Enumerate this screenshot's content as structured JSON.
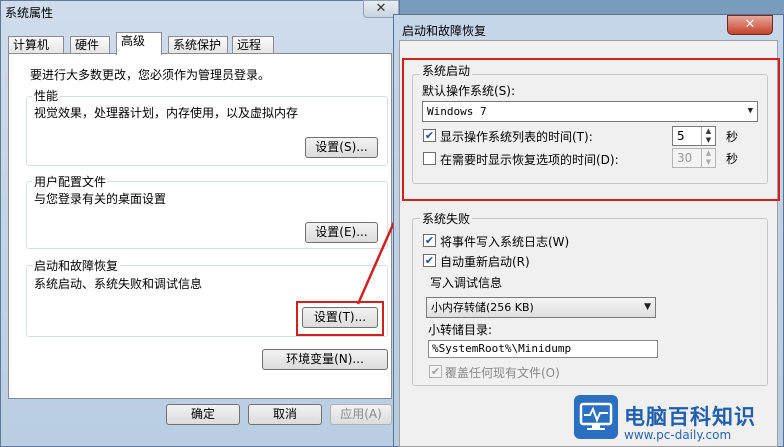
{
  "sysprops": {
    "title": "系统属性",
    "tabs": [
      "计算机名",
      "硬件",
      "高级",
      "系统保护",
      "远程"
    ],
    "intro": "要进行大多数更改，您必须作为管理员登录。",
    "performance": {
      "label": "性能",
      "desc": "视觉效果，处理器计划，内存使用，以及虚拟内存",
      "button": "设置(S)..."
    },
    "profiles": {
      "label": "用户配置文件",
      "desc": "与您登录有关的桌面设置",
      "button": "设置(E)..."
    },
    "startup": {
      "label": "启动和故障恢复",
      "desc": "系统启动、系统失败和调试信息",
      "button": "设置(T)..."
    },
    "env_button": "环境变量(N)...",
    "ok": "确定",
    "cancel": "取消",
    "apply": "应用(A)"
  },
  "dialog": {
    "title": "启动和故障恢复",
    "close": "✕",
    "system_start": {
      "label": "系统启动",
      "default_os_label": "默认操作系统(S):",
      "default_os": "Windows 7",
      "show_list_label": "显示操作系统列表的时间(T):",
      "show_list_checked": true,
      "show_list_value": "5",
      "show_recovery_label": "在需要时显示恢复选项的时间(D):",
      "show_recovery_checked": false,
      "show_recovery_value": "30",
      "seconds": "秒"
    },
    "system_failure": {
      "label": "系统失败",
      "write_log_label": "将事件写入系统日志(W)",
      "write_log_checked": true,
      "auto_restart_label": "自动重新启动(R)",
      "auto_restart_checked": true,
      "debug_info_label": "写入调试信息",
      "debug_type": "小内存转储(256 KB)",
      "dump_dir_label": "小转储目录:",
      "dump_dir": "%SystemRoot%\\Minidump",
      "overwrite_label": "覆盖任何现有文件(O)",
      "overwrite_checked": true
    }
  },
  "watermark": {
    "brand": "电脑百科知识",
    "url": "www.pc-daily.com"
  },
  "colors": {
    "highlight": "#d02020",
    "watermark": "#1f5fae"
  }
}
